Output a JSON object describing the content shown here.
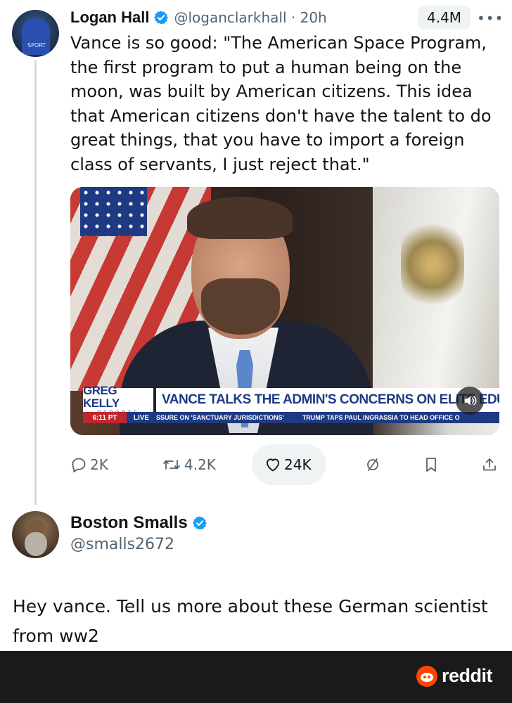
{
  "tweet": {
    "author_name": "Logan Hall",
    "handle": "@loganclarkhall",
    "separator": "·",
    "age": "20h",
    "views": "4.4M",
    "more": "•••",
    "text": "Vance is so good: \"The American Space Program, the first program to put a human being on the moon, was built by American citizens. This idea that American citizens don't have the talent to do great things, that you have to import a foreign class of servants, I just reject that.\"",
    "media": {
      "logo_main": "GREG KELLY",
      "logo_sub": "REPORTS",
      "headline": "VANCE TALKS THE ADMIN'S CONCERNS ON ELITE EDUCATION",
      "time": "6:11 PT",
      "live": "LIVE",
      "ticker": [
        "SSURE ON 'SANCTUARY JURISDICTIONS'",
        "TRUMP TAPS PAUL INGRASSIA TO HEAD OFFICE O"
      ]
    },
    "actions": {
      "replies": "2K",
      "reposts": "4.2K",
      "likes": "24K"
    },
    "accent": "#1d9bf0"
  },
  "reply": {
    "author_name": "Boston Smalls",
    "handle": "@smalls2672",
    "text": "Hey vance. Tell us more about these German scientist from ww2"
  },
  "footer": {
    "brand": "reddit",
    "brand_color": "#ff4500"
  }
}
